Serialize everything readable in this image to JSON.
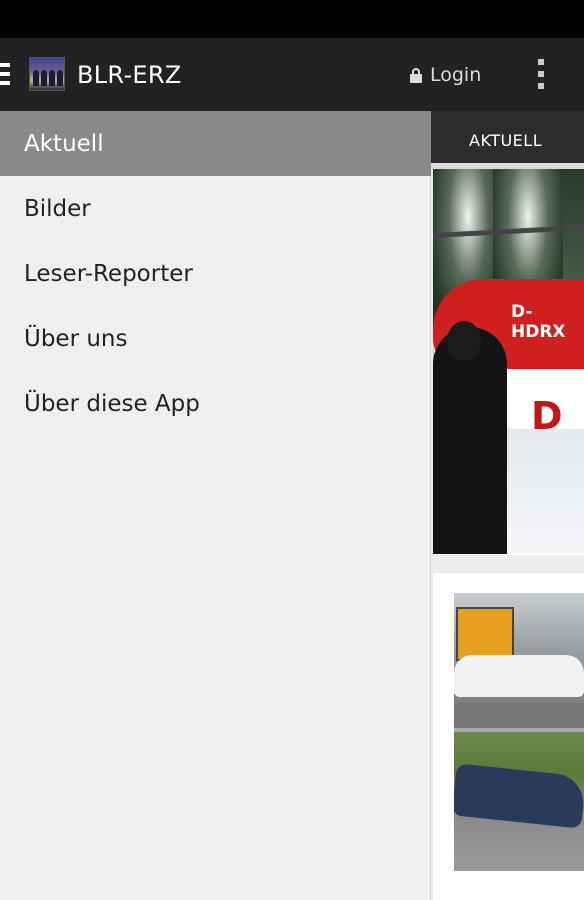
{
  "app": {
    "title": "BLR-ERZ",
    "login_label": "Login"
  },
  "icons": {
    "drawer": "menu-icon",
    "logo": "app-logo",
    "lock": "lock-icon",
    "overflow": "overflow-menu-icon"
  },
  "drawer": {
    "items": [
      {
        "label": "Aktuell",
        "selected": true
      },
      {
        "label": "Bilder",
        "selected": false
      },
      {
        "label": "Leser-Reporter",
        "selected": false
      },
      {
        "label": "Über uns",
        "selected": false
      },
      {
        "label": "Über diese App",
        "selected": false
      }
    ]
  },
  "content": {
    "tabs": [
      {
        "label": "AKTUELL",
        "selected": true
      }
    ],
    "cards": [
      {
        "image": "helicopter-photo",
        "registration": "D-HDRX",
        "logo_text": "D"
      },
      {
        "image": "car-crash-photo"
      },
      {
        "image": ""
      }
    ]
  },
  "colors": {
    "status_bar": "#000000",
    "action_bar": "#222222",
    "drawer_bg": "#efefef",
    "drawer_selected": "#8a8a8a",
    "tab_bar": "#2c2c2c"
  }
}
